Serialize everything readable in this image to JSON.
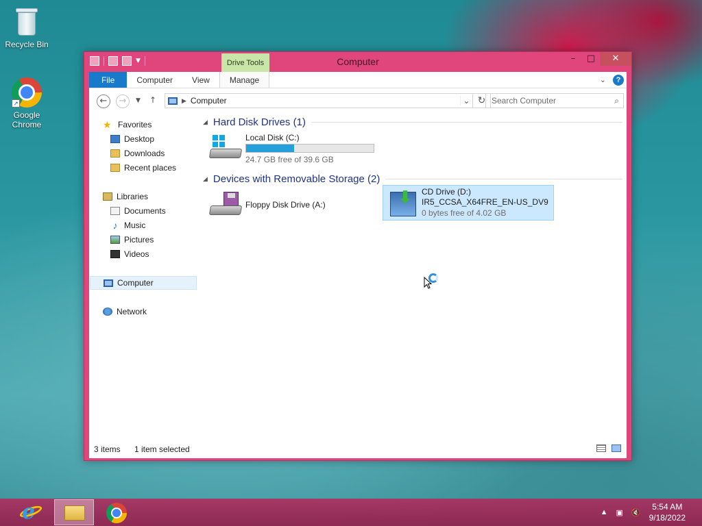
{
  "desktop": {
    "icons": [
      {
        "label": "Recycle Bin"
      },
      {
        "label_line1": "Google",
        "label_line2": "Chrome"
      }
    ]
  },
  "window": {
    "title": "Computer",
    "contextual_tab": "Drive Tools",
    "ribbon_tabs": [
      "File",
      "Computer",
      "View",
      "Manage"
    ],
    "address": "Computer",
    "search_placeholder": "Search Computer",
    "nav": {
      "favorites": "Favorites",
      "favorites_items": [
        "Desktop",
        "Downloads",
        "Recent places"
      ],
      "libraries": "Libraries",
      "libraries_items": [
        "Documents",
        "Music",
        "Pictures",
        "Videos"
      ],
      "computer": "Computer",
      "network": "Network"
    },
    "groups": [
      {
        "title": "Hard Disk Drives (1)"
      },
      {
        "title": "Devices with Removable Storage (2)"
      }
    ],
    "drives": {
      "local": {
        "name": "Local Disk (C:)",
        "free": "24.7 GB free of 39.6 GB",
        "used_fraction": 0.376
      },
      "floppy": {
        "name": "Floppy Disk Drive (A:)"
      },
      "cd": {
        "name": "CD Drive (D:)",
        "label": "IR5_CCSA_X64FRE_EN-US_DV9",
        "free": "0 bytes free of 4.02 GB"
      }
    },
    "status": {
      "items": "3 items",
      "selected": "1 item selected"
    }
  },
  "taskbar": {
    "time": "5:54 AM",
    "date": "9/18/2022"
  },
  "colors": {
    "accent": "#e0457b",
    "file_tab": "#1979ca",
    "selection": "#cce8ff",
    "progress": "#26a0da"
  }
}
